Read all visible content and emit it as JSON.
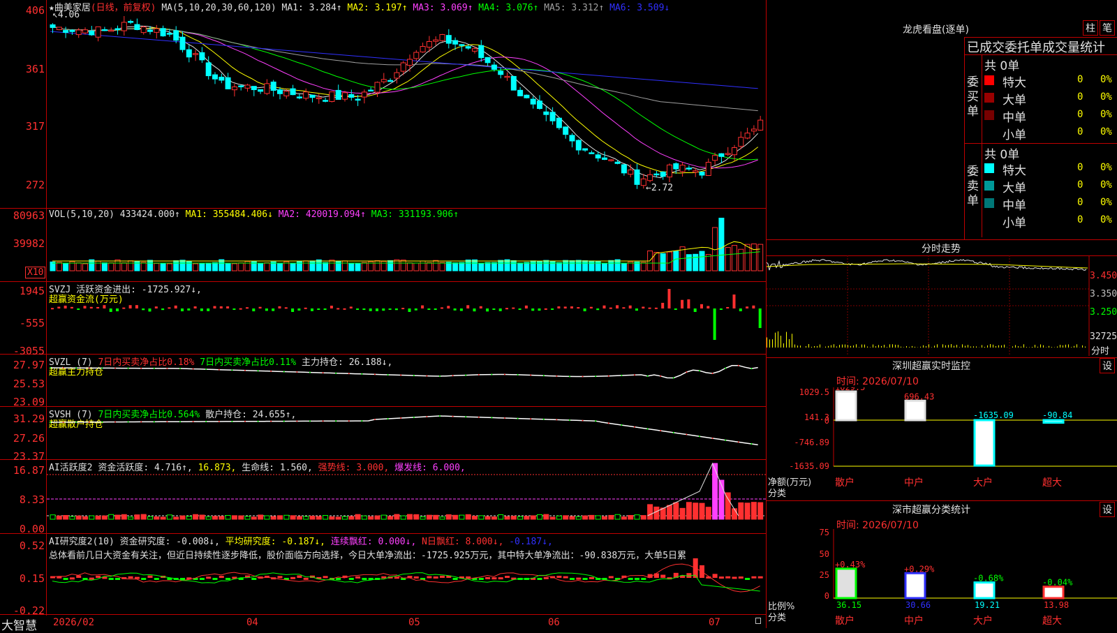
{
  "main": {
    "star": "★",
    "stock_name": "曲美家居",
    "period": "(日线，前复权)",
    "ma_header": "MA(5,10,20,30,60,120)",
    "ma": [
      {
        "label": "MA1:",
        "value": "3.284↑",
        "color": "#e0e0e0"
      },
      {
        "label": "MA2:",
        "value": "3.197↑",
        "color": "#ffff00"
      },
      {
        "label": "MA3:",
        "value": "3.069↑",
        "color": "#ff40ff"
      },
      {
        "label": "MA4:",
        "value": "3.076↑",
        "color": "#00ff00"
      },
      {
        "label": "MA5:",
        "value": "3.312↑",
        "color": "#a0a0a0"
      },
      {
        "label": "MA6:",
        "value": "3.509↓",
        "color": "#3030ff"
      }
    ],
    "y_ticks": [
      "406",
      "361",
      "317",
      "272"
    ],
    "high_label": "4.06",
    "low_label": "←2.72"
  },
  "vol": {
    "title": "VOL(5,10,20)",
    "value": "433424.000↑",
    "ma1": "MA1: 355484.406↓",
    "ma2": "MA2: 420019.094↑",
    "ma3": "MA3: 331193.906↑",
    "y_ticks": [
      "80963",
      "39982"
    ],
    "unit": "X10"
  },
  "svzj": {
    "title": "SVZJ",
    "label": "活跃资金进出: -1725.927↓,",
    "subtitle": "超赢资金流(万元)",
    "y_ticks": [
      "1945",
      "-555",
      "-3055"
    ]
  },
  "svzl": {
    "title": "SVZL (7)",
    "part1": "7日内买卖净占比0.18%",
    "part2": "7日内买卖净占比0.11%",
    "part3": "主力持仓: 26.188↓,",
    "subtitle": "超赢主力持仓",
    "y_ticks": [
      "27.97",
      "25.53",
      "23.09"
    ]
  },
  "svsh": {
    "title": "SVSH (7)",
    "part1": "7日内买卖净占比0.564%",
    "part2": "散户持仓: 24.655↑,",
    "subtitle": "超赢散户持仓",
    "y_ticks": [
      "31.29",
      "27.26",
      "23.37"
    ]
  },
  "ai_active": {
    "title": "AI活跃度2",
    "p1": "资金活跃度: 4.716↑,",
    "p2": "16.873,",
    "p3": "生命线: 1.560,",
    "p4": "强势线: 3.000,",
    "p5": "爆发线: 6.000,",
    "y_ticks": [
      "16.87",
      "8.33",
      "0.00"
    ]
  },
  "ai_research": {
    "title": "AI研究度2(10)",
    "p1": "资金研究度: -0.008↓,",
    "p2": "平均研究度: -0.187↓,",
    "p3": "连续飘红: 0.000↓,",
    "p4": "N日飘红: 8.000↓,",
    "p5": "-0.187↓,",
    "summary": "总体看前几日大资金有关注，但近日持续性逐步降低，股价面临方向选择，今日大单净流出：-1725.925万元，其中特大单净流出：-90.838万元，大单5日累",
    "y_ticks": [
      "0.52",
      "0.15",
      "-0.22"
    ]
  },
  "bottom": {
    "brand": "大智慧",
    "dates": [
      "2026/02",
      "04",
      "05",
      "06",
      "07"
    ]
  },
  "right": {
    "lhkp_title": "龙虎看盘(逐单)",
    "btn_zhu": "柱",
    "btn_bi": "笔",
    "stat_title": "已成交委托单成交量统计",
    "buy_label": "委买单",
    "sell_label": "委卖单",
    "total_buy": "共 0单",
    "total_sell": "共 0单",
    "rows": [
      "特大",
      "大单",
      "中单",
      "小单"
    ],
    "zero": "0",
    "pct": "0%",
    "fenshi_title": "分时走势",
    "fenshi_prices": [
      "3.450",
      "3.350",
      "3.250"
    ],
    "fenshi_vol": "32725",
    "fenshi_unit": "分时",
    "sz_monitor_title": "深圳超赢实时监控",
    "set_btn": "设",
    "monitor_time": "时间: 2026/07/10",
    "monitor_ticks": [
      "1029.5",
      "141.3",
      "0",
      "-746.89",
      "-1635.09"
    ],
    "monitor_ylabel1": "净额(万元)",
    "monitor_ylabel2": "分类",
    "categories": [
      "散户",
      "中户",
      "大户",
      "超大"
    ],
    "monitor_vals": [
      "1029.5",
      "696.43",
      "-1635.09",
      "-90.84"
    ],
    "classify_title": "深市超赢分类统计",
    "classify_time": "时间: 2026/07/10",
    "classify_ticks": [
      "75",
      "50",
      "25",
      "0"
    ],
    "classify_ylabel1": "比例%",
    "classify_ylabel2": "分类",
    "classify_changes": [
      "+0.43%",
      "+0.29%",
      "-0.68%",
      "-0.04%"
    ],
    "classify_vals": [
      "36.15",
      "30.66",
      "19.21",
      "13.98"
    ],
    "classify_values_num": [
      36.15,
      30.66,
      19.21,
      13.98
    ],
    "monitor_values_num": [
      1029.5,
      696.43,
      -1635.09,
      -90.84
    ]
  }
}
